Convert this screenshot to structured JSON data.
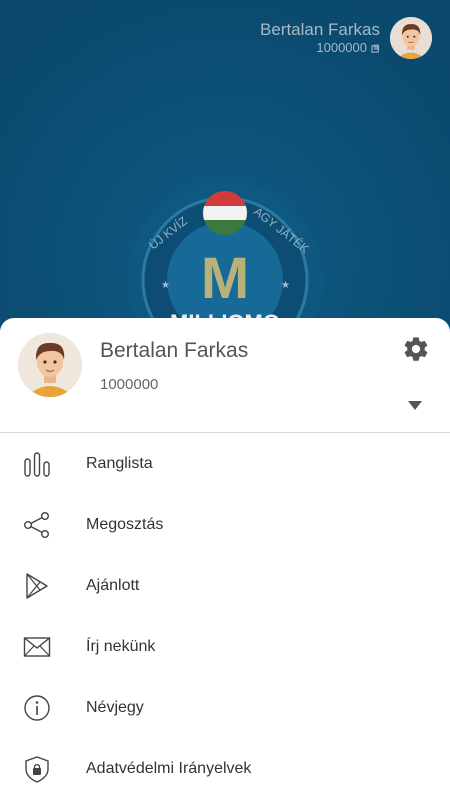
{
  "header": {
    "user_name": "Bertalan Farkas",
    "coins": "1000000",
    "coin_icon": "coin-icon",
    "avatar_icon": "avatar"
  },
  "background_logo": {
    "top_text": "ÚJ KVÍZ · AGY JÁTÉK",
    "letter": "M",
    "bottom_text": "MILLIOMO"
  },
  "profile": {
    "name": "Bertalan Farkas",
    "coins": "1000000",
    "settings_icon": "gear-icon",
    "expand_icon": "chevron-down-icon"
  },
  "menu": [
    {
      "label": "Ranglista",
      "icon": "leaderboard-icon"
    },
    {
      "label": "Megosztás",
      "icon": "share-icon"
    },
    {
      "label": "Ajánlott",
      "icon": "play-store-icon"
    },
    {
      "label": "Írj nekünk",
      "icon": "mail-icon"
    },
    {
      "label": "Névjegy",
      "icon": "info-icon"
    },
    {
      "label": "Adatvédelmi Irányelvek",
      "icon": "privacy-shield-icon"
    }
  ],
  "colors": {
    "background": "#0b4a6f",
    "sheet": "#ffffff",
    "text": "#333333"
  }
}
